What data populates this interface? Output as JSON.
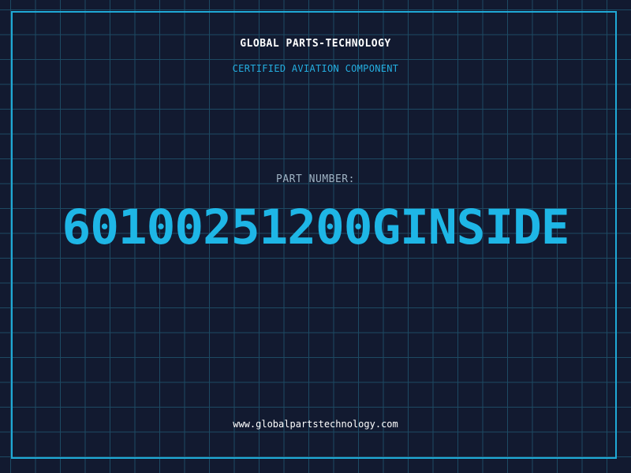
{
  "header": {
    "brand": "GLOBAL PARTS-TECHNOLOGY",
    "subtitle": "CERTIFIED AVIATION COMPONENT"
  },
  "main": {
    "label": "PART NUMBER:",
    "part_number": "60100251200GINSIDE"
  },
  "footer": {
    "url": "www.globalpartstechnology.com"
  },
  "colors": {
    "background": "#121a30",
    "grid": "#1d4a63",
    "accent": "#1eb6e6",
    "frame": "#1fa9d6"
  }
}
